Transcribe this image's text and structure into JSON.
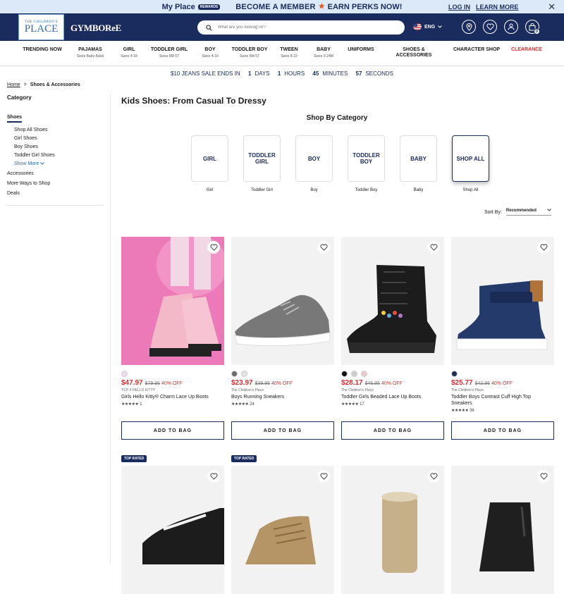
{
  "promo": {
    "my_place": "My Place",
    "rewards": "REWARDS",
    "become": "BECOME A MEMBER",
    "earn": "EARN PERKS NOW!",
    "login": "LOG IN",
    "learn": "LEARN MORE"
  },
  "header": {
    "logo_line1": "THE CHILDREN'S",
    "logo_line2": "PLACE",
    "gymboree": "GYMBOReE",
    "search_placeholder": "What are you looking for?",
    "lang": "ENG",
    "cart_count": "0"
  },
  "nav": [
    {
      "label": "TRENDING NOW",
      "sub": ""
    },
    {
      "label": "PAJAMAS",
      "sub": "Sizes Baby-Adult"
    },
    {
      "label": "GIRL",
      "sub": "Sizes 4-18"
    },
    {
      "label": "TODDLER GIRL",
      "sub": "Sizes 6M-5T"
    },
    {
      "label": "BOY",
      "sub": "Sizes 4-18"
    },
    {
      "label": "TODDLER BOY",
      "sub": "Sizes 6M-5T"
    },
    {
      "label": "TWEEN",
      "sub": "Sizes 8-22"
    },
    {
      "label": "BABY",
      "sub": "Sizes 0-24M"
    },
    {
      "label": "UNIFORMS",
      "sub": ""
    },
    {
      "label": "SHOES &",
      "label2": "ACCESSORIES",
      "sub": ""
    },
    {
      "label": "CHARACTER SHOP",
      "sub": ""
    },
    {
      "label": "CLEARANCE",
      "sub": ""
    }
  ],
  "sale": {
    "text": "$10 JEANS SALE ENDS IN",
    "days": "1",
    "days_l": "DAYS",
    "hours": "1",
    "hours_l": "HOURS",
    "minutes": "45",
    "minutes_l": "MINUTES",
    "seconds": "57",
    "seconds_l": "SECONDS"
  },
  "breadcrumb": {
    "home": "Home",
    "sep": ">",
    "current": "Shoes & Accessories"
  },
  "sidebar": {
    "category": "Category",
    "shoes": "Shoes",
    "subs": [
      "Shop All Shoes",
      "Girl Shoes",
      "Boy Shoes",
      "Toddler Girl Shoes"
    ],
    "show_more": "Show More",
    "tops": [
      "Accessories",
      "More Ways to Shop",
      "Deals"
    ]
  },
  "page": {
    "title": "Kids Shoes: From Casual To Dressy",
    "shop_by": "Shop By Category",
    "sort_label": "Sort By:",
    "sort_value": "Recommended"
  },
  "categories": [
    {
      "card": "GIRL",
      "card2": "",
      "label": "Girl"
    },
    {
      "card": "TODDLER",
      "card2": "GIRL",
      "label": "Toddler Girl"
    },
    {
      "card": "BOY",
      "card2": "",
      "label": "Boy"
    },
    {
      "card": "TODDLER",
      "card2": "BOY",
      "label": "Toddler Boy"
    },
    {
      "card": "BABY",
      "card2": "",
      "label": "Baby"
    },
    {
      "card": "SHOP ALL",
      "card2": "",
      "label": "Shop All"
    }
  ],
  "products": [
    {
      "price": "$47.97",
      "was": "$79.95",
      "off": "40% OFF",
      "brand": "TCP X HELLO KITTY",
      "name": "Girls Hello Kitty® Charm Lace Up Boots",
      "name2": "",
      "stars": "★★★★★",
      "reviews": "1",
      "swatches": [
        "#eedcf0"
      ],
      "bg": "#e86fb0"
    },
    {
      "price": "$23.97",
      "was": "$39.95",
      "off": "40% OFF",
      "brand": "The Children's Place",
      "name": "Boys Running Sneakers",
      "name2": "",
      "stars": "★★★★★",
      "reviews": "24",
      "swatches": [
        "#6b6b6b",
        "#e4e4e4"
      ],
      "bg": "#f3f3f3"
    },
    {
      "price": "$28.17",
      "was": "$46.95",
      "off": "40% OFF",
      "brand": "The Children's Place",
      "name": "Toddler Girls Beaded Lace Up Boots",
      "name2": "",
      "stars": "★★★★★",
      "reviews": "17",
      "swatches": [
        "#111111",
        "#cfcfcf",
        "#efc9cd"
      ],
      "bg": "#f3f3f3"
    },
    {
      "price": "$25.77",
      "was": "$42.95",
      "off": "40% OFF",
      "brand": "The Children's Place",
      "name": "Toddler Boys Contrast Cuff High Top",
      "name2": "Sneakers",
      "stars": "★★★★★",
      "reviews": "36",
      "swatches": [
        "#1f2d55"
      ],
      "bg": "#f3f3f3"
    }
  ],
  "add_to_bag": "ADD TO BAG",
  "top_rated": "TOP RATED"
}
